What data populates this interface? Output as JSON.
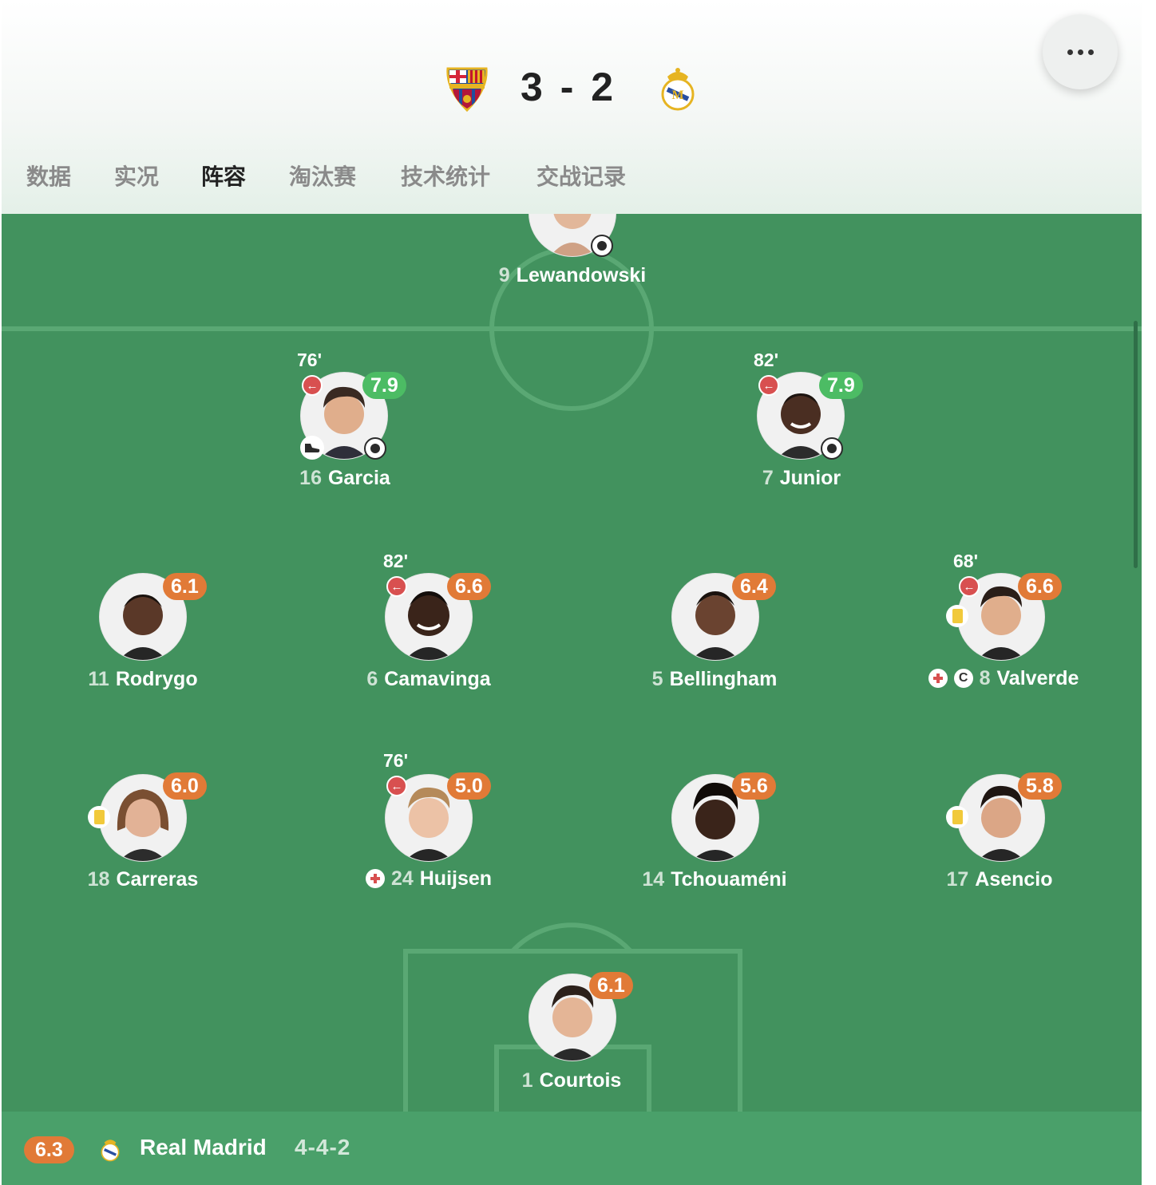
{
  "match": {
    "home_team": "FC Barcelona",
    "away_team": "Real Madrid",
    "score": "3 - 2",
    "home_crest_icon": "fc-barcelona-crest-icon",
    "away_crest_icon": "real-madrid-crest-icon",
    "more_icon": "more-options-icon"
  },
  "tabs": [
    {
      "label": "数据",
      "active": false
    },
    {
      "label": "实况",
      "active": false
    },
    {
      "label": "阵容",
      "active": true
    },
    {
      "label": "淘汰赛",
      "active": false
    },
    {
      "label": "技术统计",
      "active": false
    },
    {
      "label": "交战记录",
      "active": false
    }
  ],
  "lineup": {
    "players": [
      {
        "number": "9",
        "name": "Lewandowski",
        "events": [
          "goal"
        ]
      },
      {
        "number": "16",
        "name": "Garcia",
        "rating": "7.9",
        "rating_color": "green",
        "sub_minute": "76'",
        "events": [
          "subbed-off",
          "assist",
          "goal"
        ]
      },
      {
        "number": "7",
        "name": "Junior",
        "rating": "7.9",
        "rating_color": "green",
        "sub_minute": "82'",
        "events": [
          "subbed-off",
          "goal"
        ]
      },
      {
        "number": "11",
        "name": "Rodrygo",
        "rating": "6.1",
        "rating_color": "orange"
      },
      {
        "number": "6",
        "name": "Camavinga",
        "rating": "6.6",
        "rating_color": "orange",
        "sub_minute": "82'",
        "events": [
          "subbed-off"
        ]
      },
      {
        "number": "5",
        "name": "Bellingham",
        "rating": "6.4",
        "rating_color": "orange"
      },
      {
        "number": "8",
        "name": "Valverde",
        "rating": "6.6",
        "rating_color": "orange",
        "sub_minute": "68'",
        "events": [
          "subbed-off",
          "yellow-card",
          "injury",
          "captain"
        ]
      },
      {
        "number": "18",
        "name": "Carreras",
        "rating": "6.0",
        "rating_color": "orange",
        "events": [
          "yellow-card"
        ]
      },
      {
        "number": "24",
        "name": "Huijsen",
        "rating": "5.0",
        "rating_color": "orange",
        "sub_minute": "76'",
        "events": [
          "subbed-off",
          "injury"
        ]
      },
      {
        "number": "14",
        "name": "Tchouaméni",
        "rating": "5.6",
        "rating_color": "orange"
      },
      {
        "number": "17",
        "name": "Asencio",
        "rating": "5.8",
        "rating_color": "orange",
        "events": [
          "yellow-card"
        ]
      },
      {
        "number": "1",
        "name": "Courtois",
        "rating": "6.1",
        "rating_color": "orange"
      }
    ],
    "captain_mark": "C"
  },
  "team_bar": {
    "rating": "6.3",
    "name": "Real Madrid",
    "formation": "4-4-2",
    "crest_icon": "real-madrid-crest-icon"
  },
  "colors": {
    "pitch": "#42925e",
    "rating_orange": "#e17a37",
    "rating_green": "#4cbc64",
    "sub_red": "#d85050",
    "yellow_card": "#f1c93b"
  }
}
